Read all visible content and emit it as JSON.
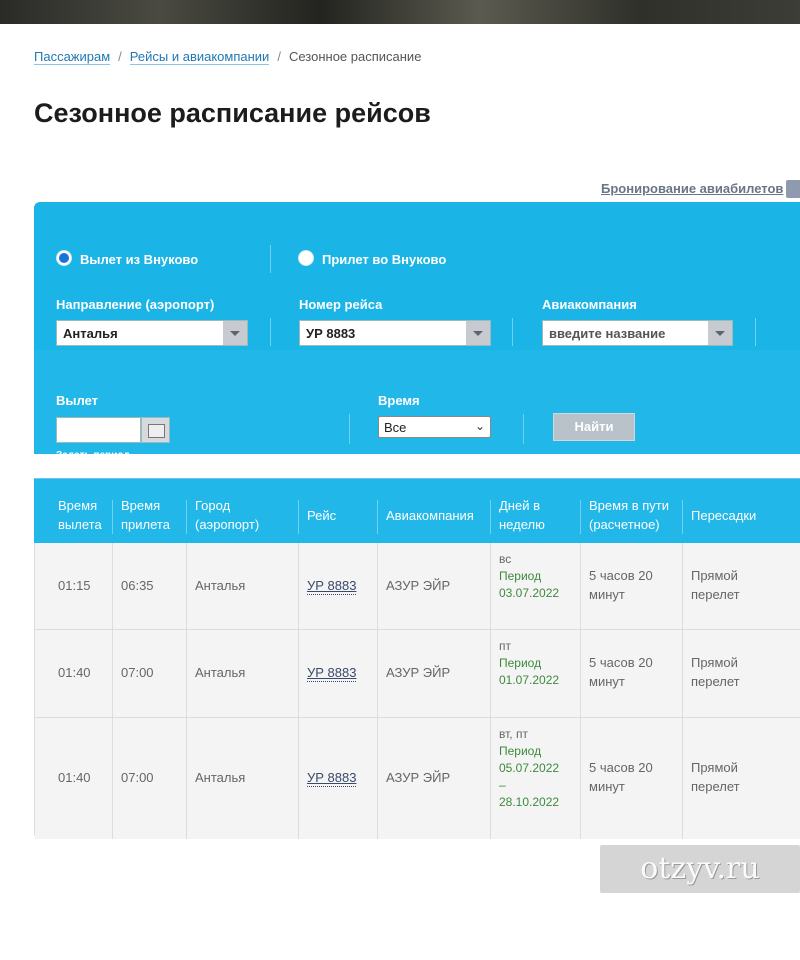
{
  "breadcrumb": {
    "items": [
      "Пассажирам",
      "Рейсы и авиакомпании",
      "Сезонное расписание"
    ],
    "separator": "/"
  },
  "page_title": "Сезонное расписание рейсов",
  "booking_link": "Бронирование авиабилетов",
  "form": {
    "radio_departure": "Вылет из Внуково",
    "radio_arrival": "Прилет во Внуково",
    "selected_radio": "departure",
    "direction_label": "Направление (аэропорт)",
    "direction_value": "Анталья",
    "flight_label": "Номер рейса",
    "flight_value": "УР 8883",
    "airline_label": "Авиакомпания",
    "airline_placeholder": "введите название",
    "departure_label": "Вылет",
    "date_value": "",
    "period_link": "Задать период",
    "time_label": "Время",
    "time_value": "Все",
    "find_button": "Найти"
  },
  "table": {
    "headers": {
      "dep": [
        "Время",
        "вылета"
      ],
      "arr": [
        "Время",
        "прилета"
      ],
      "city": [
        "Город",
        "(аэропорт)"
      ],
      "flight": [
        "Рейс"
      ],
      "airline": [
        "Авиакомпания"
      ],
      "days": [
        "Дней в",
        "неделю"
      ],
      "duration": [
        "Время в пути",
        "(расчетное)"
      ],
      "transfers": [
        "Пересадки"
      ]
    },
    "rows": [
      {
        "dep": "01:15",
        "arr": "06:35",
        "city": "Анталья",
        "flight": "УР 8883",
        "airline": "АЗУР ЭЙР",
        "weekdays": "вс",
        "period_label": "Период",
        "period_dates": [
          "03.07.2022"
        ],
        "duration": [
          "5 часов 20",
          "минут"
        ],
        "transfers": [
          "Прямой",
          "перелет"
        ]
      },
      {
        "dep": "01:40",
        "arr": "07:00",
        "city": "Анталья",
        "flight": "УР 8883",
        "airline": "АЗУР ЭЙР",
        "weekdays": "пт",
        "period_label": "Период",
        "period_dates": [
          "01.07.2022"
        ],
        "duration": [
          "5 часов 20",
          "минут"
        ],
        "transfers": [
          "Прямой",
          "перелет"
        ]
      },
      {
        "dep": "01:40",
        "arr": "07:00",
        "city": "Анталья",
        "flight": "УР 8883",
        "airline": "АЗУР ЭЙР",
        "weekdays": "вт, пт",
        "period_label": "Период",
        "period_dates": [
          "05.07.2022",
          "–",
          "28.10.2022"
        ],
        "duration": [
          "5 часов 20",
          "минут"
        ],
        "transfers": [
          "Прямой",
          "перелет"
        ]
      }
    ]
  },
  "watermark": "otzyv.ru"
}
